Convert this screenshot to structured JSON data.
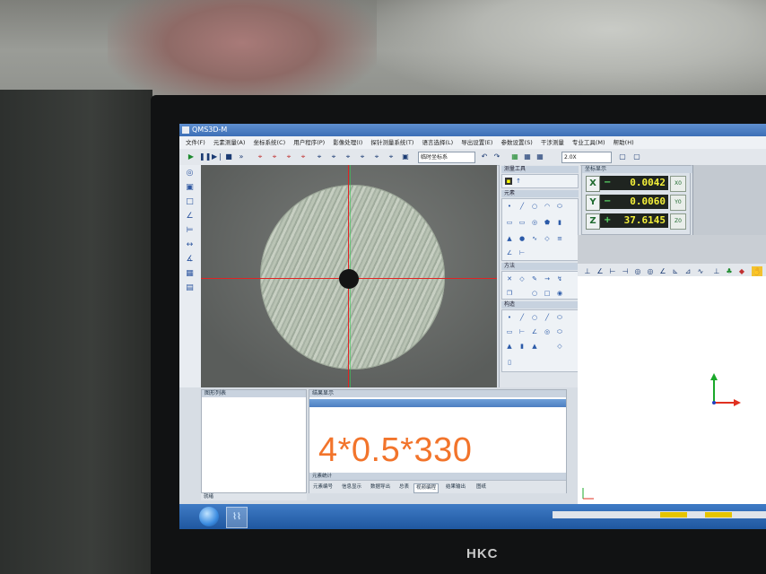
{
  "window": {
    "title": "QMS3D-M"
  },
  "menu": [
    "文件(F)",
    "元素测量(A)",
    "坐标系统(C)",
    "用户程序(P)",
    "影像处理(I)",
    "探针测量系统(T)",
    "语言选择(L)",
    "导出设置(E)",
    "参数设置(S)",
    "干涉测量",
    "专业工具(M)",
    "帮助(H)"
  ],
  "toolbar": {
    "coord_select": "临时坐标系",
    "zoom_select": "2.0X",
    "icons": [
      "play-icon",
      "pause-icon",
      "step-icon",
      "stop-icon",
      "fast-forward-icon",
      "probe-icon",
      "save-icon",
      "undo-icon",
      "redo-icon"
    ]
  },
  "tool_panel": {
    "measure_tools_title": "测量工具",
    "elements_title": "元素",
    "method_title": "方法",
    "construct_title": "构造"
  },
  "dro": {
    "title": "坐标显示",
    "axes": [
      {
        "axis": "X",
        "sign": "−",
        "value": "0.0042",
        "zero_label": "X0"
      },
      {
        "axis": "Y",
        "sign": "−",
        "value": "0.0060",
        "zero_label": "Y0"
      },
      {
        "axis": "Z",
        "sign": "+",
        "value": "37.6145",
        "zero_label": "Z0"
      }
    ]
  },
  "bottom": {
    "left_title": "图形列表",
    "mid_title": "结果显示",
    "note_text": "4*0.5*330",
    "summary_title": "元素统计",
    "tabs": [
      "元素编号",
      "信息显示",
      "数据导出",
      "总表",
      "视频编程",
      "结果输出",
      "图纸"
    ],
    "left_status": "就绪"
  },
  "brand": "HKC",
  "colors": {
    "crosshair": "#e02424",
    "note": "#f2742b",
    "dro_digits": "#f4f03a"
  }
}
